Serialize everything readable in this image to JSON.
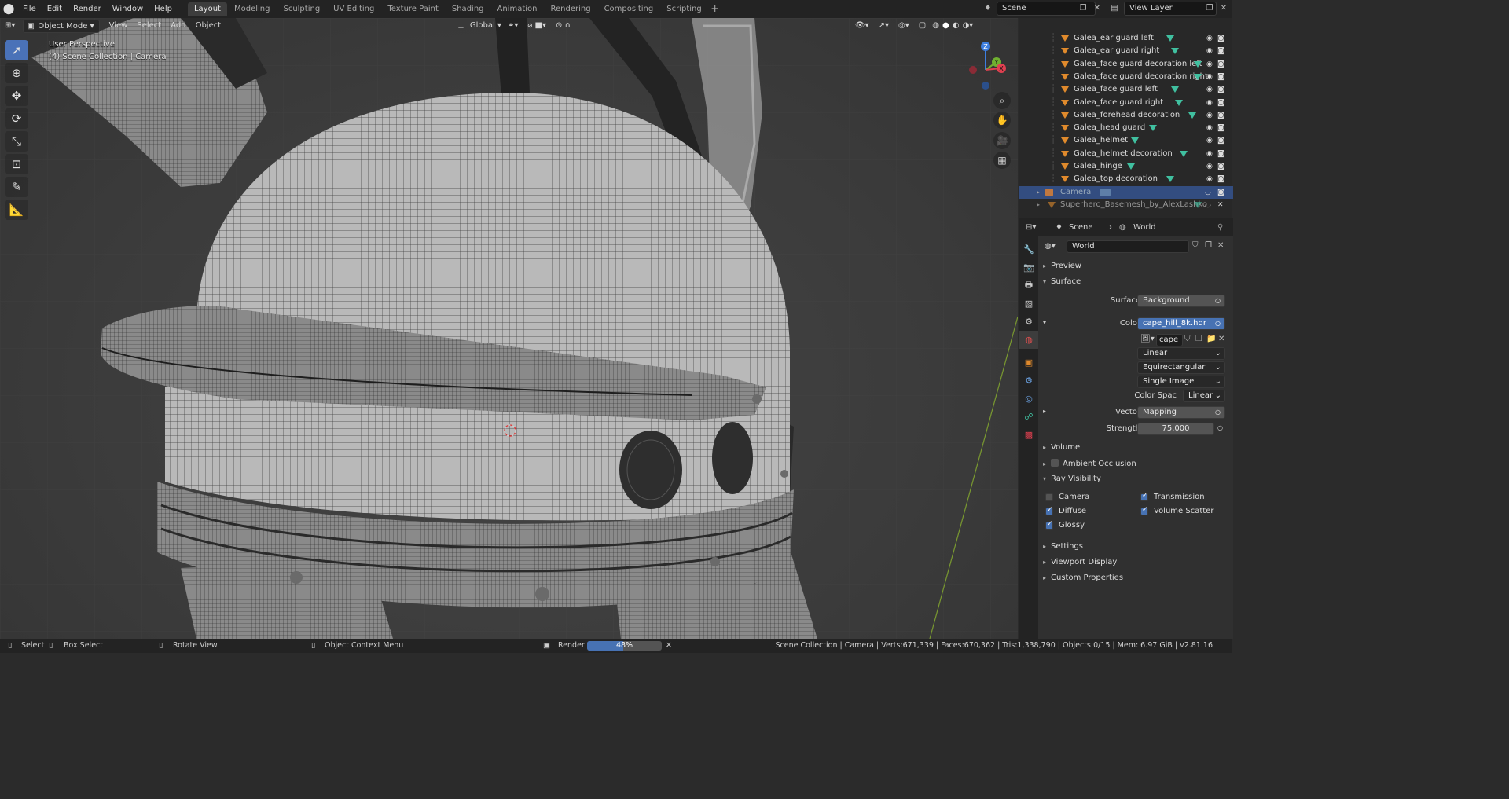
{
  "menubar": {
    "items": [
      "File",
      "Edit",
      "Render",
      "Window",
      "Help"
    ],
    "workspaces": [
      "Layout",
      "Modeling",
      "Sculpting",
      "UV Editing",
      "Texture Paint",
      "Shading",
      "Animation",
      "Rendering",
      "Compositing",
      "Scripting"
    ],
    "active_workspace": "Layout",
    "scene": "Scene",
    "view_layer": "View Layer"
  },
  "viewport": {
    "mode": "Object Mode",
    "menus": [
      "View",
      "Select",
      "Add",
      "Object"
    ],
    "orientation": "Global",
    "view_name": "User Perspective",
    "collection_info": "(4) Scene Collection | Camera",
    "gizmo": {
      "z": "Z",
      "y": "Y",
      "x": "X"
    },
    "tools": [
      "select-box-icon",
      "cursor-icon",
      "move-icon",
      "rotate-icon",
      "scale-icon",
      "transform-icon",
      "annotate-icon",
      "measure-icon"
    ]
  },
  "outliner": {
    "items": [
      "Galea_ear guard left",
      "Galea_ear guard right",
      "Galea_face guard decoration left",
      "Galea_face guard decoration right",
      "Galea_face guard left",
      "Galea_face guard right",
      "Galea_forehead decoration",
      "Galea_head guard",
      "Galea_helmet",
      "Galea_helmet decoration",
      "Galea_hinge",
      "Galea_top decoration"
    ],
    "camera": "Camera",
    "basemesh": "Superhero_Basemesh_by_AlexLashko"
  },
  "properties": {
    "breadcrumb_scene": "Scene",
    "breadcrumb_world": "World",
    "world_name": "World",
    "sections": {
      "preview": "Preview",
      "surface": "Surface",
      "volume": "Volume",
      "ambient_occlusion": "Ambient Occlusion",
      "ray_visibility": "Ray Visibility",
      "settings": "Settings",
      "viewport_display": "Viewport Display",
      "custom_properties": "Custom Properties"
    },
    "surface_label": "Surface",
    "surface_value": "Background",
    "color_label": "Color",
    "color_value": "cape_hill_8k.hdr",
    "image_name": "cape",
    "interpolation": "Linear",
    "projection": "Equirectangular",
    "source": "Single Image",
    "color_space_label": "Color Spac",
    "color_space_value": "Linear",
    "vector_label": "Vector",
    "vector_value": "Mapping",
    "strength_label": "Strength",
    "strength_value": "75.000",
    "ray": {
      "camera": "Camera",
      "camera_checked": false,
      "transmission": "Transmission",
      "transmission_checked": true,
      "diffuse": "Diffuse",
      "diffuse_checked": true,
      "volume_scatter": "Volume Scatter",
      "volume_scatter_checked": true,
      "glossy": "Glossy",
      "glossy_checked": true
    }
  },
  "statusbar": {
    "select": "Select",
    "box_select": "Box Select",
    "rotate_view": "Rotate View",
    "context_menu": "Object Context Menu",
    "render_label": "Render",
    "render_progress": 0.48,
    "render_progress_text": "48%",
    "stats": "Scene Collection | Camera | Verts:671,339 | Faces:670,362 | Tris:1,338,790 | Objects:0/15 | Mem: 6.97 GiB | v2.81.16"
  },
  "colors": {
    "accent": "#4772b3",
    "object_orange": "#e08a2c",
    "mesh_green": "#40c0a0",
    "x_axis": "#e04050",
    "y_axis": "#70b030",
    "z_axis": "#3d7ee0"
  }
}
